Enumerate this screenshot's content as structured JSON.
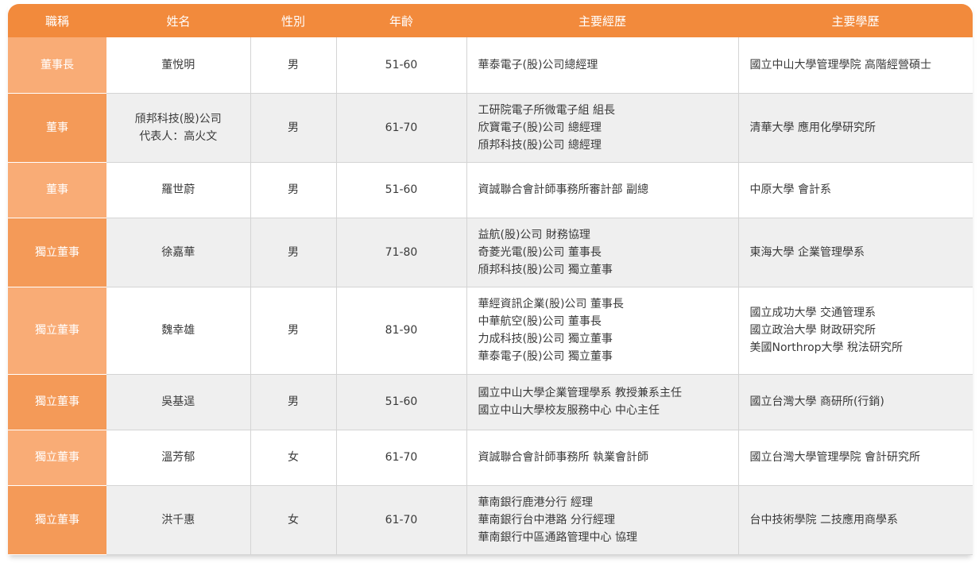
{
  "headers": [
    "職稱",
    "姓名",
    "性別",
    "年齡",
    "主要經歷",
    "主要學歷"
  ],
  "rows": [
    {
      "title": "董事長",
      "name": [
        "董悅明"
      ],
      "gender": "男",
      "age": "51-60",
      "experience": [
        "華泰電子(股)公司總經理"
      ],
      "education": [
        "國立中山大學管理學院 高階經營碩士"
      ]
    },
    {
      "title": "董事",
      "name": [
        "頎邦科技(股)公司",
        "代表人：高火文"
      ],
      "gender": "男",
      "age": "61-70",
      "experience": [
        "工研院電子所微電子組 組長",
        "欣寶電子(股)公司 總經理",
        "頎邦科技(股)公司 總經理"
      ],
      "education": [
        "清華大學 應用化學研究所"
      ]
    },
    {
      "title": "董事",
      "name": [
        "羅世蔚"
      ],
      "gender": "男",
      "age": "51-60",
      "experience": [
        "資誠聯合會計師事務所審計部 副總"
      ],
      "education": [
        "中原大學 會計系"
      ]
    },
    {
      "title": "獨立董事",
      "name": [
        "徐嘉華"
      ],
      "gender": "男",
      "age": "71-80",
      "experience": [
        "益航(股)公司 財務協理",
        "奇菱光電(股)公司 董事長",
        "頎邦科技(股)公司 獨立董事"
      ],
      "education": [
        "東海大學 企業管理學系"
      ]
    },
    {
      "title": "獨立董事",
      "name": [
        "魏幸雄"
      ],
      "gender": "男",
      "age": "81-90",
      "experience": [
        "華經資訊企業(股)公司 董事長",
        "中華航空(股)公司 董事長",
        "力成科技(股)公司 獨立董事",
        "華泰電子(股)公司 獨立董事"
      ],
      "education": [
        "國立成功大學 交通管理系",
        "國立政治大學 財政研究所",
        "美國Northrop大學 稅法研究所"
      ]
    },
    {
      "title": "獨立董事",
      "name": [
        "吳基逞"
      ],
      "gender": "男",
      "age": "51-60",
      "experience": [
        "國立中山大學企業管理學系 教授兼系主任",
        "國立中山大學校友服務中心 中心主任"
      ],
      "education": [
        "國立台灣大學 商研所(行銷)"
      ]
    },
    {
      "title": "獨立董事",
      "name": [
        "溫芳郁"
      ],
      "gender": "女",
      "age": "61-70",
      "experience": [
        "資誠聯合會計師事務所 執業會計師"
      ],
      "education": [
        "國立台灣大學管理學院 會計研究所"
      ]
    },
    {
      "title": "獨立董事",
      "name": [
        "洪千惠"
      ],
      "gender": "女",
      "age": "61-70",
      "experience": [
        "華南銀行鹿港分行 經理",
        "華南銀行台中港路 分行經理",
        "華南銀行中區通路管理中心 協理"
      ],
      "education": [
        "台中技術學院 二技應用商學系"
      ]
    }
  ]
}
